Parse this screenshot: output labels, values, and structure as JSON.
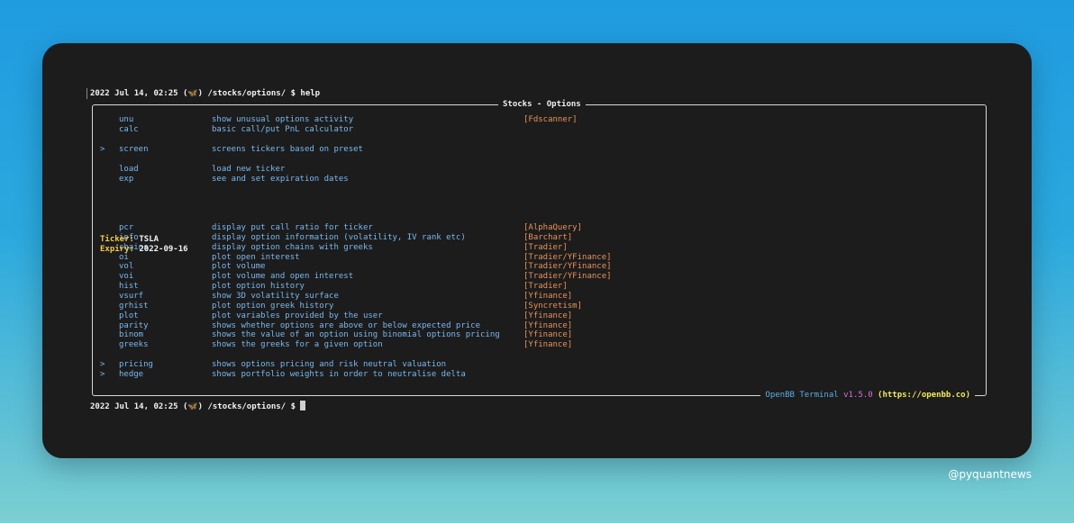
{
  "prompt_top": {
    "datetime": "2022 Jul 14, 02:25",
    "butterfly": "🦋",
    "path": "/stocks/options/",
    "symbol": "$",
    "command": "help"
  },
  "prompt_bottom": {
    "datetime": "2022 Jul 14, 02:25",
    "butterfly": "🦋",
    "path": "/stocks/options/",
    "symbol": "$"
  },
  "panel": {
    "title": "Stocks - Options",
    "footer": {
      "name": "OpenBB Terminal",
      "version": "v1.5.0",
      "url": "(https://openbb.co)"
    }
  },
  "group1": [
    {
      "arrow": "",
      "cmd": "unu",
      "desc": "show unusual options activity",
      "src": "[Fdscanner]"
    },
    {
      "arrow": "",
      "cmd": "calc",
      "desc": "basic call/put PnL calculator",
      "src": ""
    }
  ],
  "group2": [
    {
      "arrow": ">",
      "cmd": "screen",
      "desc": "screens tickers based on preset",
      "src": ""
    }
  ],
  "group3": [
    {
      "arrow": "",
      "cmd": "load",
      "desc": "load new ticker",
      "src": ""
    },
    {
      "arrow": "",
      "cmd": "exp",
      "desc": "see and set expiration dates",
      "src": ""
    }
  ],
  "info": {
    "ticker_label": "Ticker:",
    "ticker_value": "TSLA",
    "expiry_label": "Expiry:",
    "expiry_value": "2022-09-16"
  },
  "group4": [
    {
      "arrow": "",
      "cmd": "pcr",
      "desc": "display put call ratio for ticker",
      "src": "[AlphaQuery]"
    },
    {
      "arrow": "",
      "cmd": "info",
      "desc": "display option information (volatility, IV rank etc)",
      "src": "[Barchart]"
    },
    {
      "arrow": "",
      "cmd": "chains",
      "desc": "display option chains with greeks",
      "src": "[Tradier]"
    },
    {
      "arrow": "",
      "cmd": "oi",
      "desc": "plot open interest",
      "src": "[Tradier/YFinance]"
    },
    {
      "arrow": "",
      "cmd": "vol",
      "desc": "plot volume",
      "src": "[Tradier/YFinance]"
    },
    {
      "arrow": "",
      "cmd": "voi",
      "desc": "plot volume and open interest",
      "src": "[Tradier/YFinance]"
    },
    {
      "arrow": "",
      "cmd": "hist",
      "desc": "plot option history",
      "src": "[Tradier]"
    },
    {
      "arrow": "",
      "cmd": "vsurf",
      "desc": "show 3D volatility surface",
      "src": "[Yfinance]"
    },
    {
      "arrow": "",
      "cmd": "grhist",
      "desc": "plot option greek history",
      "src": "[Syncretism]"
    },
    {
      "arrow": "",
      "cmd": "plot",
      "desc": "plot variables provided by the user",
      "src": "[Yfinance]"
    },
    {
      "arrow": "",
      "cmd": "parity",
      "desc": "shows whether options are above or below expected price",
      "src": "[Yfinance]"
    },
    {
      "arrow": "",
      "cmd": "binom",
      "desc": "shows the value of an option using binomial options pricing",
      "src": "[Yfinance]"
    },
    {
      "arrow": "",
      "cmd": "greeks",
      "desc": "shows the greeks for a given option",
      "src": "[Yfinance]"
    }
  ],
  "group5": [
    {
      "arrow": ">",
      "cmd": "pricing",
      "desc": "shows options pricing and risk neutral valuation",
      "src": ""
    },
    {
      "arrow": ">",
      "cmd": "hedge",
      "desc": "shows portfolio weights in order to neutralise delta",
      "src": ""
    }
  ],
  "watermark": "@pyquantnews",
  "colors": {
    "background_top": "#1f9be0",
    "background_bottom": "#7ccfd2",
    "terminal_bg": "#1c1c1c",
    "command": "#79b8f0",
    "source": "#e8935a",
    "label": "#f2c94c"
  }
}
